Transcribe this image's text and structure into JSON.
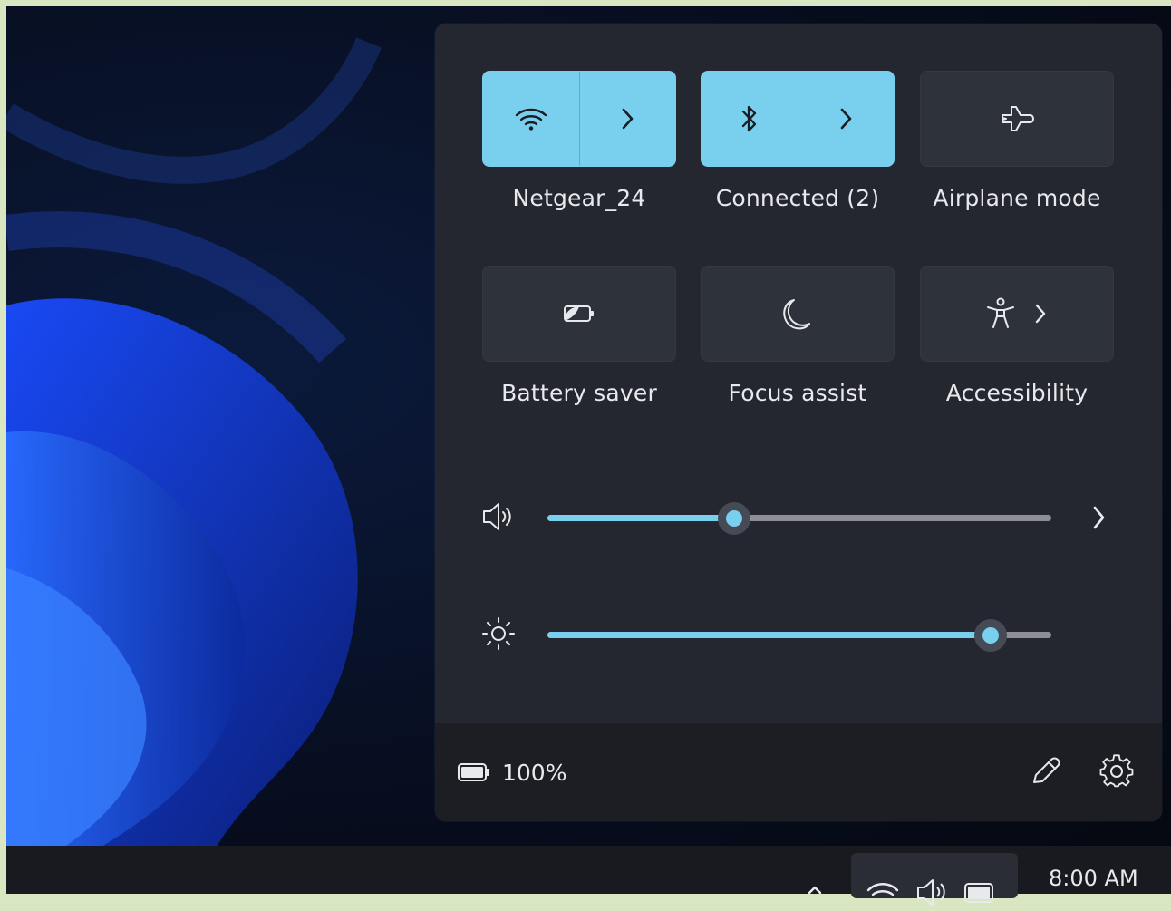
{
  "quick_settings": {
    "tiles": [
      {
        "label": "Netgear_24",
        "icon": "wifi-icon",
        "state": "on",
        "has_expand": true
      },
      {
        "label": "Connected (2)",
        "icon": "bluetooth-icon",
        "state": "on",
        "has_expand": true
      },
      {
        "label": "Airplane mode",
        "icon": "airplane-icon",
        "state": "off",
        "has_expand": false
      },
      {
        "label": "Battery saver",
        "icon": "battery-saver-icon",
        "state": "off",
        "has_expand": false
      },
      {
        "label": "Focus assist",
        "icon": "moon-icon",
        "state": "off",
        "has_expand": false
      },
      {
        "label": "Accessibility",
        "icon": "accessibility-icon",
        "state": "off",
        "has_expand": true
      }
    ],
    "volume": {
      "icon": "volume-icon",
      "level": 0.37
    },
    "brightness": {
      "icon": "brightness-icon",
      "level": 0.88
    },
    "footer": {
      "battery_percent": "100%",
      "edit_icon": "pencil-icon",
      "settings_icon": "gear-icon"
    }
  },
  "taskbar": {
    "clock_time": "8:00 AM",
    "tray_icons": [
      "wifi-icon",
      "volume-icon",
      "battery-icon"
    ]
  },
  "colors": {
    "accent": "#78cfee",
    "panel": "#24272f",
    "tile_off": "#2e323b"
  }
}
